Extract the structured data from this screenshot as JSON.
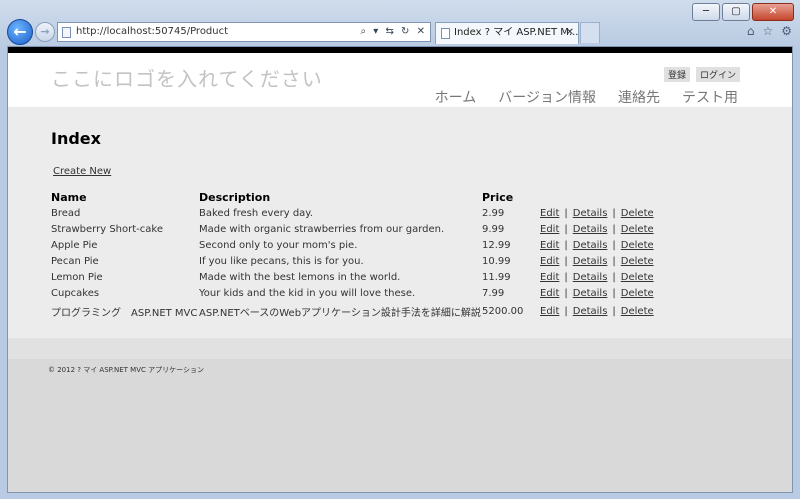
{
  "browser": {
    "url": "http://localhost:50745/Product",
    "tab_title": "Index ? マイ ASP.NET M...",
    "window_buttons": {
      "minimize": "─",
      "maximize": "▢",
      "close": "✕"
    },
    "back_glyph": "←",
    "forward_glyph": "→",
    "addr_tools": "⌕ ▾ ⇆ ↻ ✕",
    "tab_close": "✕",
    "toolbar_icons": {
      "home": "⌂",
      "favorites": "☆",
      "settings": "⚙"
    }
  },
  "site": {
    "logo_text": "ここにロゴを入れてください",
    "auth": {
      "register": "登録",
      "login": "ログイン"
    },
    "nav": [
      "ホーム",
      "バージョン情報",
      "連絡先",
      "テスト用"
    ]
  },
  "page": {
    "title": "Index",
    "create_new": "Create New",
    "columns": [
      "Name",
      "Description",
      "Price"
    ],
    "action_labels": {
      "edit": "Edit",
      "details": "Details",
      "delete": "Delete",
      "sep": "|"
    },
    "rows": [
      {
        "name": "Bread",
        "description": "Baked fresh every day.",
        "price": "2.99"
      },
      {
        "name": "Strawberry Short-cake",
        "description": "Made with organic strawberries from our garden.",
        "price": "9.99"
      },
      {
        "name": "Apple Pie",
        "description": "Second only to your mom's pie.",
        "price": "12.99"
      },
      {
        "name": "Pecan Pie",
        "description": "If you like pecans, this is for you.",
        "price": "10.99"
      },
      {
        "name": "Lemon Pie",
        "description": "Made with the best lemons in the world.",
        "price": "11.99"
      },
      {
        "name": "Cupcakes",
        "description": "Your kids and the kid in you will love these.",
        "price": "7.99"
      },
      {
        "name": "プログラミング　ASP.NET MVC",
        "description": "ASP.NETベースのWebアプリケーション設計手法を詳細に解説",
        "price": "5200.00"
      }
    ]
  },
  "footer": {
    "text": "© 2012 ? マイ ASP.NET MVC アプリケーション"
  }
}
